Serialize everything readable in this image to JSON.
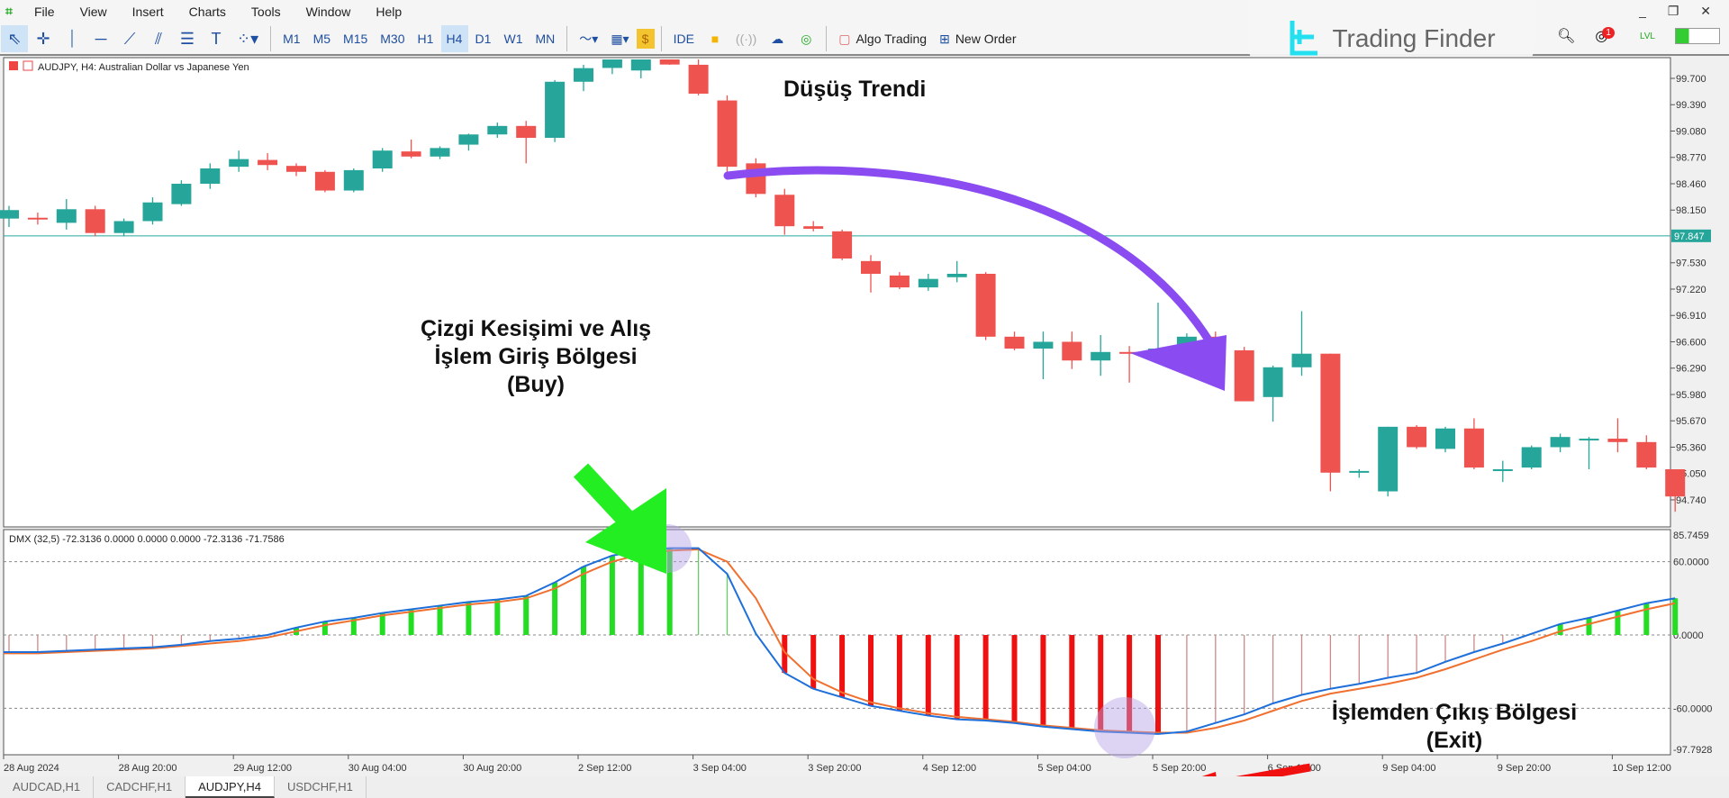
{
  "menu": [
    "File",
    "View",
    "Insert",
    "Charts",
    "Tools",
    "Window",
    "Help"
  ],
  "window_controls": "_ ❐ ✕",
  "toolbar": {
    "tools": [
      "cursor-icon",
      "crosshair-icon",
      "vertical-line-icon",
      "horizontal-line-icon",
      "trendline-icon",
      "channel-icon",
      "fibonacci-icon",
      "text-icon",
      "shapes-icon"
    ],
    "timeframes": [
      "M1",
      "M5",
      "M15",
      "M30",
      "H1",
      "H4",
      "D1",
      "W1",
      "MN"
    ],
    "active_timeframe": "H4",
    "ide": "IDE",
    "algo_trading": "Algo Trading",
    "new_order": "New Order",
    "notifications": "1",
    "lvl": "LVL"
  },
  "brand": "Trading Finder",
  "chart": {
    "title": "AUDJPY, H4:  Australian Dollar vs Japanese Yen",
    "bull_color": "#26a69a",
    "bear_color": "#ef5350",
    "price_labels": [
      "99.700",
      "99.390",
      "99.080",
      "98.770",
      "98.460",
      "98.150",
      "97.530",
      "97.220",
      "96.910",
      "96.600",
      "96.290",
      "95.980",
      "95.670",
      "95.360",
      "95.050",
      "94.740"
    ],
    "current_price": "97.847",
    "candles": [
      [
        98.05,
        98.2,
        97.95,
        98.15
      ],
      [
        98.06,
        98.12,
        97.98,
        98.05
      ],
      [
        98.0,
        98.28,
        97.92,
        98.16
      ],
      [
        98.16,
        98.2,
        97.84,
        97.88
      ],
      [
        97.88,
        98.05,
        97.84,
        98.02
      ],
      [
        98.02,
        98.3,
        97.98,
        98.24
      ],
      [
        98.22,
        98.5,
        98.2,
        98.46
      ],
      [
        98.46,
        98.7,
        98.4,
        98.64
      ],
      [
        98.66,
        98.85,
        98.6,
        98.75
      ],
      [
        98.74,
        98.82,
        98.62,
        98.68
      ],
      [
        98.67,
        98.7,
        98.55,
        98.6
      ],
      [
        98.6,
        98.62,
        98.36,
        98.38
      ],
      [
        98.38,
        98.64,
        98.36,
        98.62
      ],
      [
        98.64,
        98.88,
        98.6,
        98.85
      ],
      [
        98.84,
        98.98,
        98.76,
        98.78
      ],
      [
        98.78,
        98.9,
        98.75,
        98.88
      ],
      [
        98.92,
        99.05,
        98.85,
        99.04
      ],
      [
        99.04,
        99.18,
        99.0,
        99.14
      ],
      [
        99.14,
        99.2,
        98.7,
        99.0
      ],
      [
        99.0,
        99.68,
        98.95,
        99.66
      ],
      [
        99.66,
        99.86,
        99.55,
        99.82
      ],
      [
        99.86,
        99.98,
        99.75,
        99.96
      ],
      [
        99.82,
        99.98,
        99.7,
        99.95
      ],
      [
        99.94,
        99.96,
        99.86,
        99.88
      ],
      [
        99.86,
        99.98,
        99.5,
        99.52
      ],
      [
        99.44,
        99.5,
        98.6,
        98.66
      ],
      [
        98.7,
        98.76,
        98.3,
        98.34
      ],
      [
        98.33,
        98.4,
        97.86,
        97.96
      ],
      [
        97.96,
        98.02,
        97.9,
        97.93
      ],
      [
        97.9,
        97.92,
        97.56,
        97.58
      ],
      [
        97.55,
        97.62,
        97.18,
        97.4
      ],
      [
        97.38,
        97.42,
        97.22,
        97.24
      ],
      [
        97.24,
        97.4,
        97.2,
        97.34
      ],
      [
        97.36,
        97.55,
        97.3,
        97.4
      ],
      [
        97.4,
        97.42,
        96.62,
        96.66
      ],
      [
        96.66,
        96.72,
        96.5,
        96.52
      ],
      [
        96.52,
        96.72,
        96.16,
        96.6
      ],
      [
        96.6,
        96.72,
        96.28,
        96.38
      ],
      [
        96.38,
        96.68,
        96.2,
        96.48
      ],
      [
        96.48,
        96.55,
        96.12,
        96.47
      ],
      [
        96.46,
        97.06,
        96.4,
        96.52
      ],
      [
        96.56,
        96.7,
        96.4,
        96.66
      ],
      [
        96.66,
        96.72,
        96.45,
        96.48
      ],
      [
        96.5,
        96.54,
        95.9,
        95.9
      ],
      [
        95.95,
        96.32,
        95.66,
        96.3
      ],
      [
        96.3,
        96.96,
        96.2,
        96.46
      ],
      [
        96.46,
        96.46,
        94.84,
        95.06
      ],
      [
        95.06,
        95.1,
        95.0,
        95.08
      ],
      [
        94.84,
        95.6,
        94.78,
        95.6
      ],
      [
        95.6,
        95.62,
        95.34,
        95.36
      ],
      [
        95.34,
        95.6,
        95.3,
        95.58
      ],
      [
        95.58,
        95.7,
        95.1,
        95.12
      ],
      [
        95.1,
        95.2,
        94.95,
        95.1
      ],
      [
        95.12,
        95.38,
        95.1,
        95.36
      ],
      [
        95.36,
        95.52,
        95.3,
        95.48
      ],
      [
        95.46,
        95.48,
        95.1,
        95.46
      ],
      [
        95.46,
        95.7,
        95.3,
        95.42
      ],
      [
        95.42,
        95.5,
        95.1,
        95.12
      ],
      [
        95.1,
        95.1,
        94.6,
        94.78
      ]
    ],
    "time_labels": [
      "28 Aug 2024",
      "28 Aug 20:00",
      "29 Aug 12:00",
      "30 Aug 04:00",
      "30 Aug 20:00",
      "2 Sep 12:00",
      "3 Sep 04:00",
      "3 Sep 20:00",
      "4 Sep 12:00",
      "5 Sep 04:00",
      "5 Sep 20:00",
      "6 Sep 12:00",
      "9 Sep 04:00",
      "9 Sep 20:00",
      "10 Sep 12:00"
    ]
  },
  "indicator": {
    "label": "DMX (32,5) -72.3136 0.0000 0.0000 0.0000 -72.3136 -71.7586",
    "scale_labels": [
      "85.7459",
      "60.0000",
      "0.0000",
      "-60.0000",
      "-97.7928"
    ],
    "main_color": "#1e6fd9",
    "signal_color": "#f07030",
    "pos_color": "#22dd22",
    "neg_color": "#ee1111",
    "main": [
      -14,
      -14,
      -13,
      -12,
      -11,
      -10,
      -8,
      -5,
      -3,
      0,
      6,
      11,
      14,
      18,
      21,
      24,
      27,
      29,
      32,
      43,
      56,
      65,
      69,
      71,
      71,
      50,
      1,
      -31,
      -44,
      -51,
      -58,
      -62,
      -66,
      -69,
      -70,
      -72,
      -75,
      -77,
      -79,
      -80,
      -81,
      -79,
      -72,
      -65,
      -56,
      -49,
      -44,
      -40,
      -35,
      -31,
      -22,
      -14,
      -7,
      1,
      9,
      14,
      20,
      26,
      30
    ],
    "signal": [
      -15,
      -15,
      -14,
      -13,
      -12,
      -11,
      -9,
      -7,
      -5,
      -2,
      3,
      8,
      12,
      16,
      19,
      22,
      25,
      27,
      30,
      38,
      50,
      60,
      66,
      69,
      70,
      60,
      30,
      -14,
      -36,
      -47,
      -55,
      -60,
      -64,
      -67,
      -69,
      -71,
      -74,
      -76,
      -78,
      -79,
      -80,
      -80,
      -76,
      -70,
      -62,
      -54,
      -48,
      -44,
      -40,
      -35,
      -28,
      -20,
      -12,
      -5,
      3,
      9,
      15,
      21,
      26
    ]
  },
  "annotations": {
    "downtrend": "Düşüş Trendi",
    "buy_line1": "Çizgi Kesişimi ve Alış",
    "buy_line2": "İşlem Giriş Bölgesi",
    "buy_line3": "(Buy)",
    "exit_line1": "İşlemden Çıkış Bölgesi",
    "exit_line2": "(Exit)"
  },
  "tabs": [
    "AUDCAD,H1",
    "CADCHF,H1",
    "AUDJPY,H4",
    "USDCHF,H1"
  ],
  "active_tab": "AUDJPY,H4"
}
